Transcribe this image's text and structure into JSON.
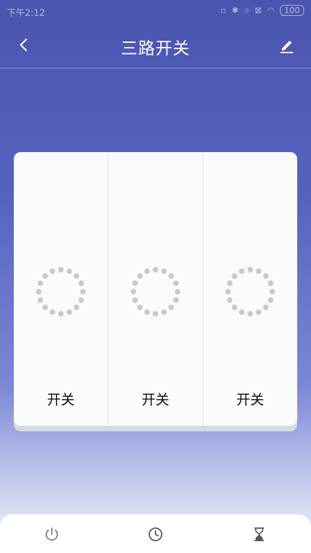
{
  "status_bar": {
    "time": "下午2:12",
    "icons": [
      "sim-icon",
      "bluetooth-icon",
      "alarm-icon",
      "signal-icon",
      "wifi-icon"
    ],
    "battery": "100"
  },
  "header": {
    "title": "三路开关",
    "back_icon": "chevron-left-icon",
    "edit_icon": "pencil-icon"
  },
  "switches": [
    {
      "label": "开关"
    },
    {
      "label": "开关"
    },
    {
      "label": "开关"
    }
  ],
  "bottom_nav": [
    {
      "icon": "power-icon"
    },
    {
      "icon": "clock-icon"
    },
    {
      "icon": "hourglass-icon"
    }
  ],
  "colors": {
    "background_top": "#4a55b0",
    "background_bottom": "#eef0fb",
    "panel": "#fbfbfc",
    "indicator_dot": "#c9c9cc"
  }
}
